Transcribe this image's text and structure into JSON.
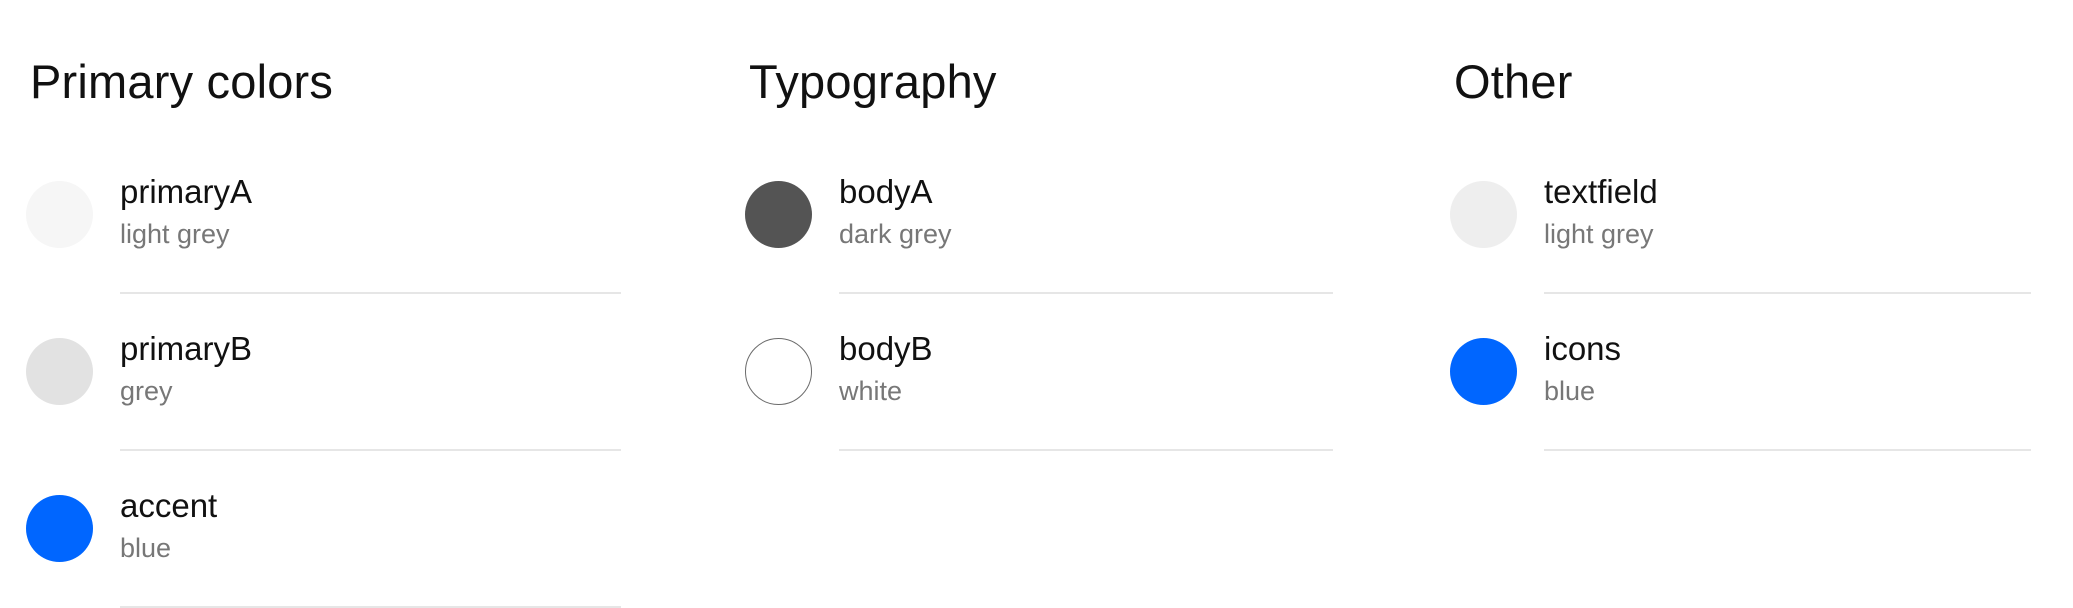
{
  "primary": {
    "title": "Primary colors",
    "items": [
      {
        "name": "primaryA",
        "desc": "light grey",
        "color": "#f6f6f6"
      },
      {
        "name": "primaryB",
        "desc": "grey",
        "color": "#e2e2e2"
      },
      {
        "name": "accent",
        "desc": "blue",
        "color": "#0066ff"
      }
    ]
  },
  "typography": {
    "title": "Typography",
    "items": [
      {
        "name": "bodyA",
        "desc": "dark grey",
        "color": "#545454"
      },
      {
        "name": "bodyB",
        "desc": "white",
        "color": "#ffffff"
      }
    ]
  },
  "other": {
    "title": "Other",
    "items": [
      {
        "name": "textfield",
        "desc": "light grey",
        "color": "#eeeeee"
      },
      {
        "name": "icons",
        "desc": "blue",
        "color": "#0066ff"
      }
    ]
  }
}
